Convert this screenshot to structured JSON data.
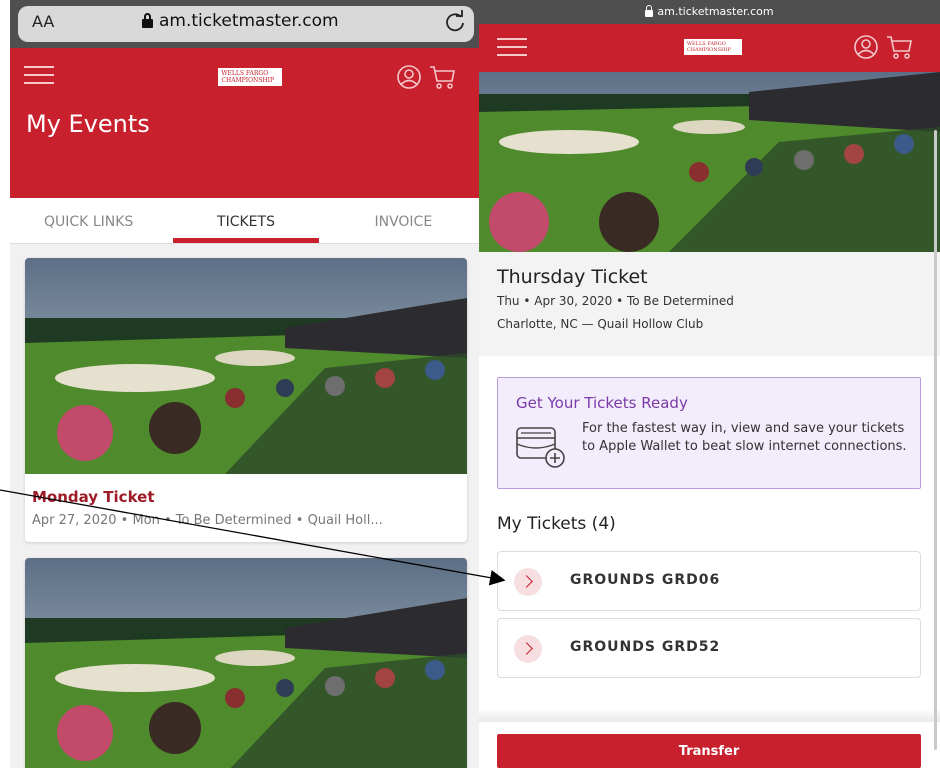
{
  "colors": {
    "brand_red": "#c8202d",
    "ticket_title_red": "#9e1b28",
    "ready_purple": "#7a3aa8"
  },
  "left": {
    "browser": {
      "text_size_label": "AA",
      "url": "am.ticketmaster.com",
      "reload_icon": "reload-icon"
    },
    "header": {
      "logo_text": "WELLS FARGO CHAMPIONSHIP",
      "title": "My Events"
    },
    "tabs": [
      {
        "label": "QUICK LINKS",
        "active": false
      },
      {
        "label": "TICKETS",
        "active": true
      },
      {
        "label": "INVOICE",
        "active": false
      }
    ],
    "cards": [
      {
        "title": "Monday Ticket",
        "subtitle": "Apr 27, 2020 • Mon • To Be Determined • Quail Holl..."
      },
      {
        "title": "",
        "subtitle": ""
      }
    ]
  },
  "right": {
    "browser": {
      "url": "am.ticketmaster.com"
    },
    "header": {
      "logo_text": "WELLS FARGO CHAMPIONSHIP"
    },
    "event": {
      "title": "Thursday Ticket",
      "date_line": "Thu • Apr 30, 2020 • To Be Determined",
      "location_line": "Charlotte, NC — Quail Hollow Club"
    },
    "wallet_promo": {
      "title": "Get Your Tickets Ready",
      "text": "For the fastest way in, view and save your tickets to Apple Wallet to beat slow internet connections."
    },
    "my_tickets_heading": "My Tickets (4)",
    "tickets": [
      {
        "label": "GROUNDS GRD06"
      },
      {
        "label": "GROUNDS GRD52"
      }
    ],
    "transfer_label": "Transfer"
  }
}
